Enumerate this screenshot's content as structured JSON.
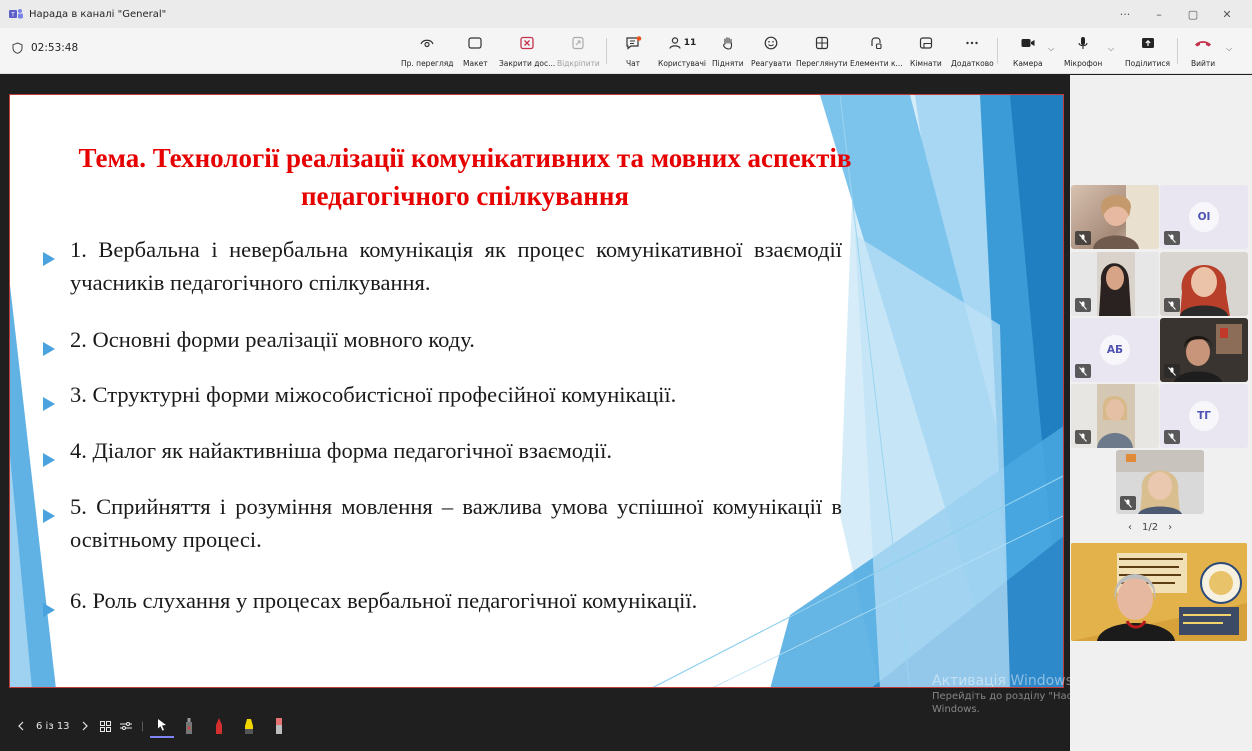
{
  "window": {
    "title": "Нарада в каналі \"General\"",
    "controls": [
      "···",
      "–",
      "▢",
      "✕"
    ]
  },
  "toolbar": {
    "timer": "02:53:48",
    "buttons": [
      {
        "label": "Пр. перегляд",
        "icon": "preview-eye-icon"
      },
      {
        "label": "Макет",
        "icon": "layout-icon"
      },
      {
        "label": "Закрити дос...",
        "icon": "close-share-icon",
        "color": "#c4314b"
      },
      {
        "label": "Відкріпити",
        "icon": "unpin-icon",
        "disabled": true
      },
      {
        "label": "Чат",
        "icon": "chat-icon"
      },
      {
        "label": "Користувачі",
        "icon": "people-icon",
        "count": "11"
      },
      {
        "label": "Підняти",
        "icon": "raise-hand-icon"
      },
      {
        "label": "Реагувати",
        "icon": "react-smile-icon"
      },
      {
        "label": "Переглянути",
        "icon": "view-grid-icon"
      },
      {
        "label": "Елементи к...",
        "icon": "apps-icon"
      },
      {
        "label": "Кімнати",
        "icon": "rooms-icon"
      },
      {
        "label": "Додатково",
        "icon": "more-icon"
      },
      {
        "label": "Камера",
        "icon": "camera-icon"
      },
      {
        "label": "Мікрофон",
        "icon": "microphone-icon"
      },
      {
        "label": "Поділитися",
        "icon": "share-icon"
      },
      {
        "label": "Вийти",
        "icon": "hang-up-icon",
        "color": "#c4314b"
      }
    ]
  },
  "slide": {
    "title": "Тема. Технології реалізації комунікативних та мовних аспектів педагогічного спілкування",
    "bullets": [
      "1. Вербальна і невербальна комунікація як процес комунікативної взаємодії учасників педагогічного спілкування.",
      "2. Основні форми реалізації мовного коду.",
      "3. Структурні форми міжособистісної професійної комунікації.",
      "4. Діалог як найактивніша форма педагогічної взаємодії.",
      "5. Сприйняття і розуміння мовлення – важлива умова успішної комунікації в освітньому процесі.",
      "6. Роль слухання у процесах вербальної педагогічної комунікації."
    ],
    "title_color": "#e60000",
    "bullet_color": "#4aa3df"
  },
  "presenter": {
    "page_indicator": "6 із 13"
  },
  "participants": {
    "initials": [
      "ОІ",
      "АБ",
      "ТГ"
    ],
    "pager": "1/2"
  },
  "watermark": {
    "line1": "Активація Windows",
    "line2": "Перейдіть до розділу \"Настройки\", щоб активувати",
    "line3": "Windows."
  }
}
